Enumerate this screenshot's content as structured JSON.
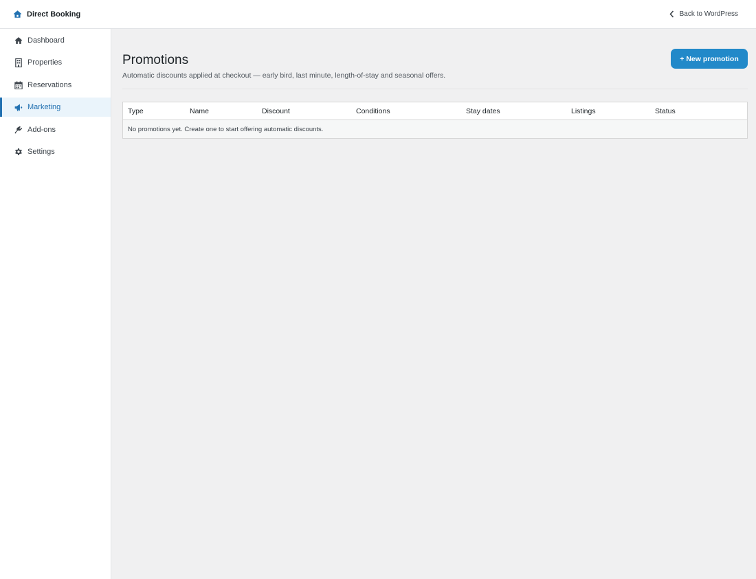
{
  "header": {
    "brand_label": "Direct Booking",
    "brand_icon": "home-icon",
    "back_label": "Back to WordPress",
    "back_icon": "chevron-left-icon"
  },
  "sidebar": {
    "items": [
      {
        "label": "Dashboard",
        "icon": "house-icon",
        "active": false
      },
      {
        "label": "Properties",
        "icon": "building-icon",
        "active": false
      },
      {
        "label": "Reservations",
        "icon": "calendar-icon",
        "active": false
      },
      {
        "label": "Marketing",
        "icon": "megaphone-icon",
        "active": true
      },
      {
        "label": "Add-ons",
        "icon": "plugin-icon",
        "active": false
      },
      {
        "label": "Settings",
        "icon": "gear-icon",
        "active": false
      }
    ]
  },
  "page": {
    "title": "Promotions",
    "subtitle": "Automatic discounts applied at checkout — early bird, last minute, length-of-stay and seasonal offers.",
    "new_button_label": "+ New promotion"
  },
  "table": {
    "columns": [
      "Type",
      "Name",
      "Discount",
      "Conditions",
      "Stay dates",
      "Listings",
      "Status"
    ],
    "empty_message": "No promotions yet. Create one to start offering automatic discounts."
  },
  "colors": {
    "accent": "#2271b1",
    "button": "#2289c9",
    "active_bg": "#eaf4fb",
    "page_bg": "#f0f0f1"
  }
}
